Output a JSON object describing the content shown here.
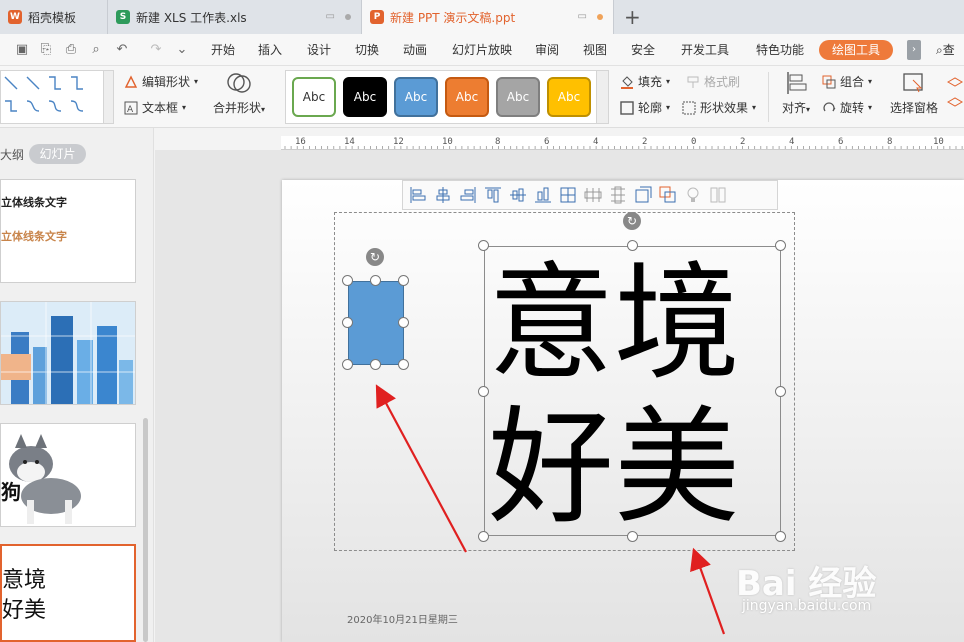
{
  "tabs": [
    {
      "label": "稻壳模板",
      "icon": "wps-logo-icon",
      "color": "#e2632e"
    },
    {
      "label": "新建 XLS 工作表.xls",
      "icon": "spreadsheet-icon",
      "color": "#2e9b5b"
    },
    {
      "label": "新建 PPT 演示文稿.ppt",
      "icon": "presentation-icon",
      "color": "#e2632e"
    }
  ],
  "new_tab": "+",
  "menu": [
    "开始",
    "插入",
    "设计",
    "切换",
    "动画",
    "幻灯片放映",
    "审阅",
    "视图",
    "安全",
    "开发工具",
    "特色功能"
  ],
  "active_tool_tab": "绘图工具",
  "search_label": "查",
  "ribbon": {
    "edit_shape": "编辑形状",
    "text_box": "文本框",
    "merge_shapes": "合并形状",
    "style_swatches": [
      {
        "label": "Abc",
        "bg": "#ffffff",
        "fg": "#333333",
        "border": "#6aa84f"
      },
      {
        "label": "Abc",
        "bg": "#000000",
        "fg": "#ffffff",
        "border": "#000000"
      },
      {
        "label": "Abc",
        "bg": "#5b9bd5",
        "fg": "#ffffff",
        "border": "#41719c"
      },
      {
        "label": "Abc",
        "bg": "#ed7d31",
        "fg": "#ffffff",
        "border": "#c55a11"
      },
      {
        "label": "Abc",
        "bg": "#a5a5a5",
        "fg": "#ffffff",
        "border": "#7f7f7f"
      },
      {
        "label": "Abc",
        "bg": "#ffc000",
        "fg": "#ffffff",
        "border": "#bf9000"
      }
    ],
    "fill": "填充",
    "format_brush": "格式刷",
    "outline": "轮廓",
    "shape_effects": "形状效果",
    "align": "对齐",
    "group": "组合",
    "rotate": "旋转",
    "selection_pane": "选择窗格"
  },
  "left_panel": {
    "outline_tab": "大纲",
    "slides_tab": "幻灯片",
    "slide1_line1": "立体线条文字",
    "slide1_line2": "立体线条文字",
    "slide3_text": "狗",
    "slide4_line1": "意境",
    "slide4_line2": "好美"
  },
  "ruler_labels": [
    "16",
    "14",
    "12",
    "10",
    "8",
    "6",
    "4",
    "2",
    "0",
    "2",
    "4",
    "6",
    "8",
    "10"
  ],
  "slide": {
    "line1": "意境",
    "line2": "好美",
    "date": "2020年10月21日星期三"
  },
  "watermark": {
    "brand": "Bai 经验",
    "url": "jingyan.baidu.com"
  }
}
